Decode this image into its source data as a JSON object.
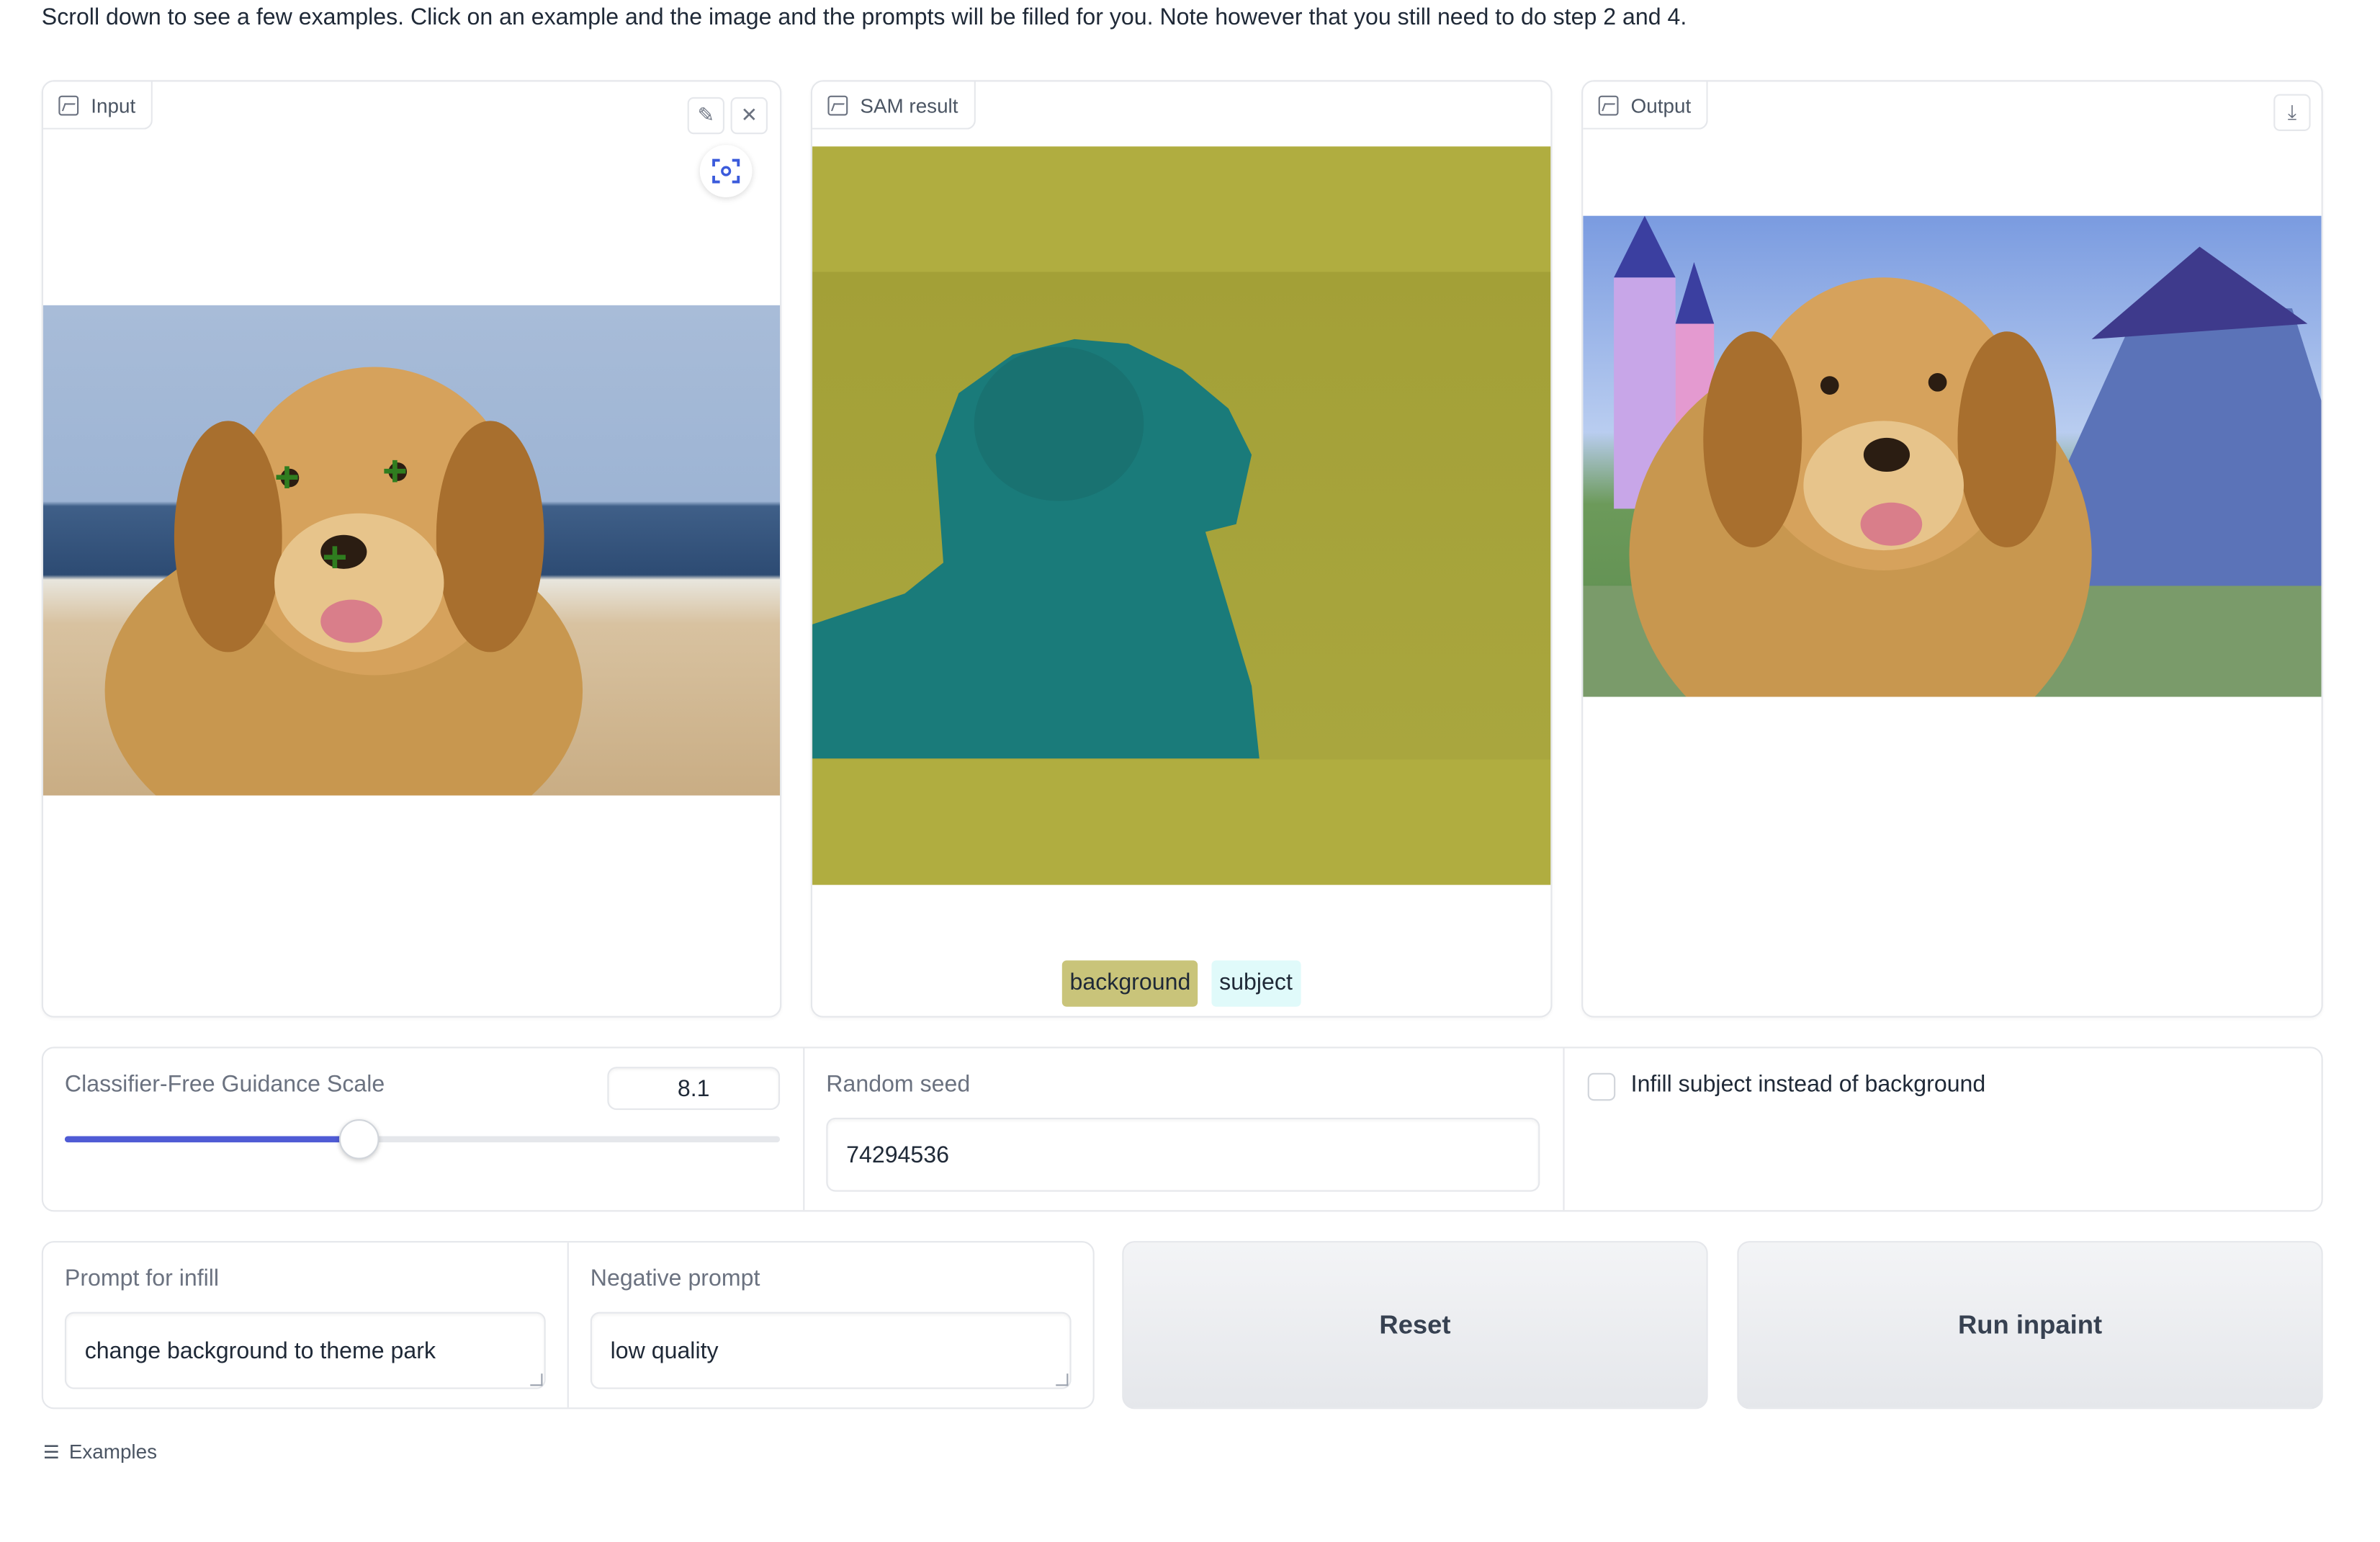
{
  "instructions": "Scroll down to see a few examples. Click on an example and the image and the prompts will be filled for you. Note however that you still need to do step 2 and 4.",
  "input_panel": {
    "label": "Input",
    "label_icon": "image-icon",
    "tools": [
      "edit-icon",
      "close-icon",
      "focus-icon"
    ]
  },
  "sam_panel": {
    "label": "SAM result",
    "label_icon": "image-icon",
    "legend": [
      {
        "label": "background",
        "color": "#c9c47a"
      },
      {
        "label": "subject",
        "color": "#e0fafa"
      }
    ]
  },
  "output_panel": {
    "label": "Output",
    "label_icon": "image-icon",
    "tools": [
      "download-icon"
    ]
  },
  "guidance": {
    "label": "Classifier-Free Guidance Scale",
    "value": "8.1",
    "slider_fraction": 0.41
  },
  "seed": {
    "label": "Random seed",
    "value": "74294536"
  },
  "infill_toggle": {
    "label": "Infill subject instead of background",
    "checked": false
  },
  "prompt": {
    "label": "Prompt for infill",
    "value": "change background to theme park"
  },
  "negative_prompt": {
    "label": "Negative prompt",
    "value": "low quality"
  },
  "buttons": {
    "reset": "Reset",
    "run": "Run inpaint"
  },
  "examples": {
    "label": "Examples",
    "icon": "list-icon"
  },
  "colors": {
    "accent": "#4f5bd5",
    "sam_background": "#b0ad40",
    "sam_subject": "#1a7b7a"
  }
}
